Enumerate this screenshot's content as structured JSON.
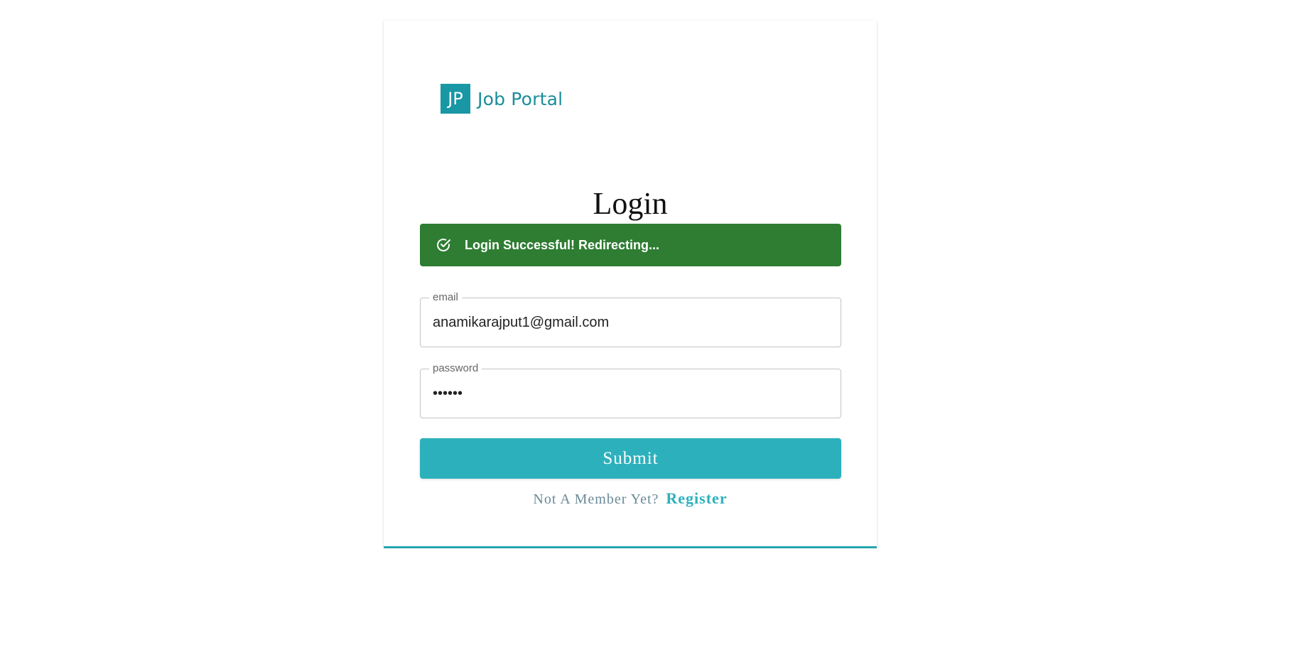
{
  "logo": {
    "badge": "JP",
    "name": "Job Portal"
  },
  "form": {
    "title": "Login",
    "alert": {
      "message": "Login Successful! Redirecting...",
      "icon": "check-circle-icon",
      "color": "#2e7d32"
    },
    "email": {
      "label": "email",
      "value": "anamikarajput1@gmail.com"
    },
    "password": {
      "label": "password",
      "value": "••••••"
    },
    "submit_label": "Submit",
    "footer": {
      "text": "Not A Member Yet?",
      "link_label": "Register"
    }
  },
  "colors": {
    "primary": "#2cb1bc",
    "logo": "#1997a4",
    "success": "#2e7d32"
  }
}
